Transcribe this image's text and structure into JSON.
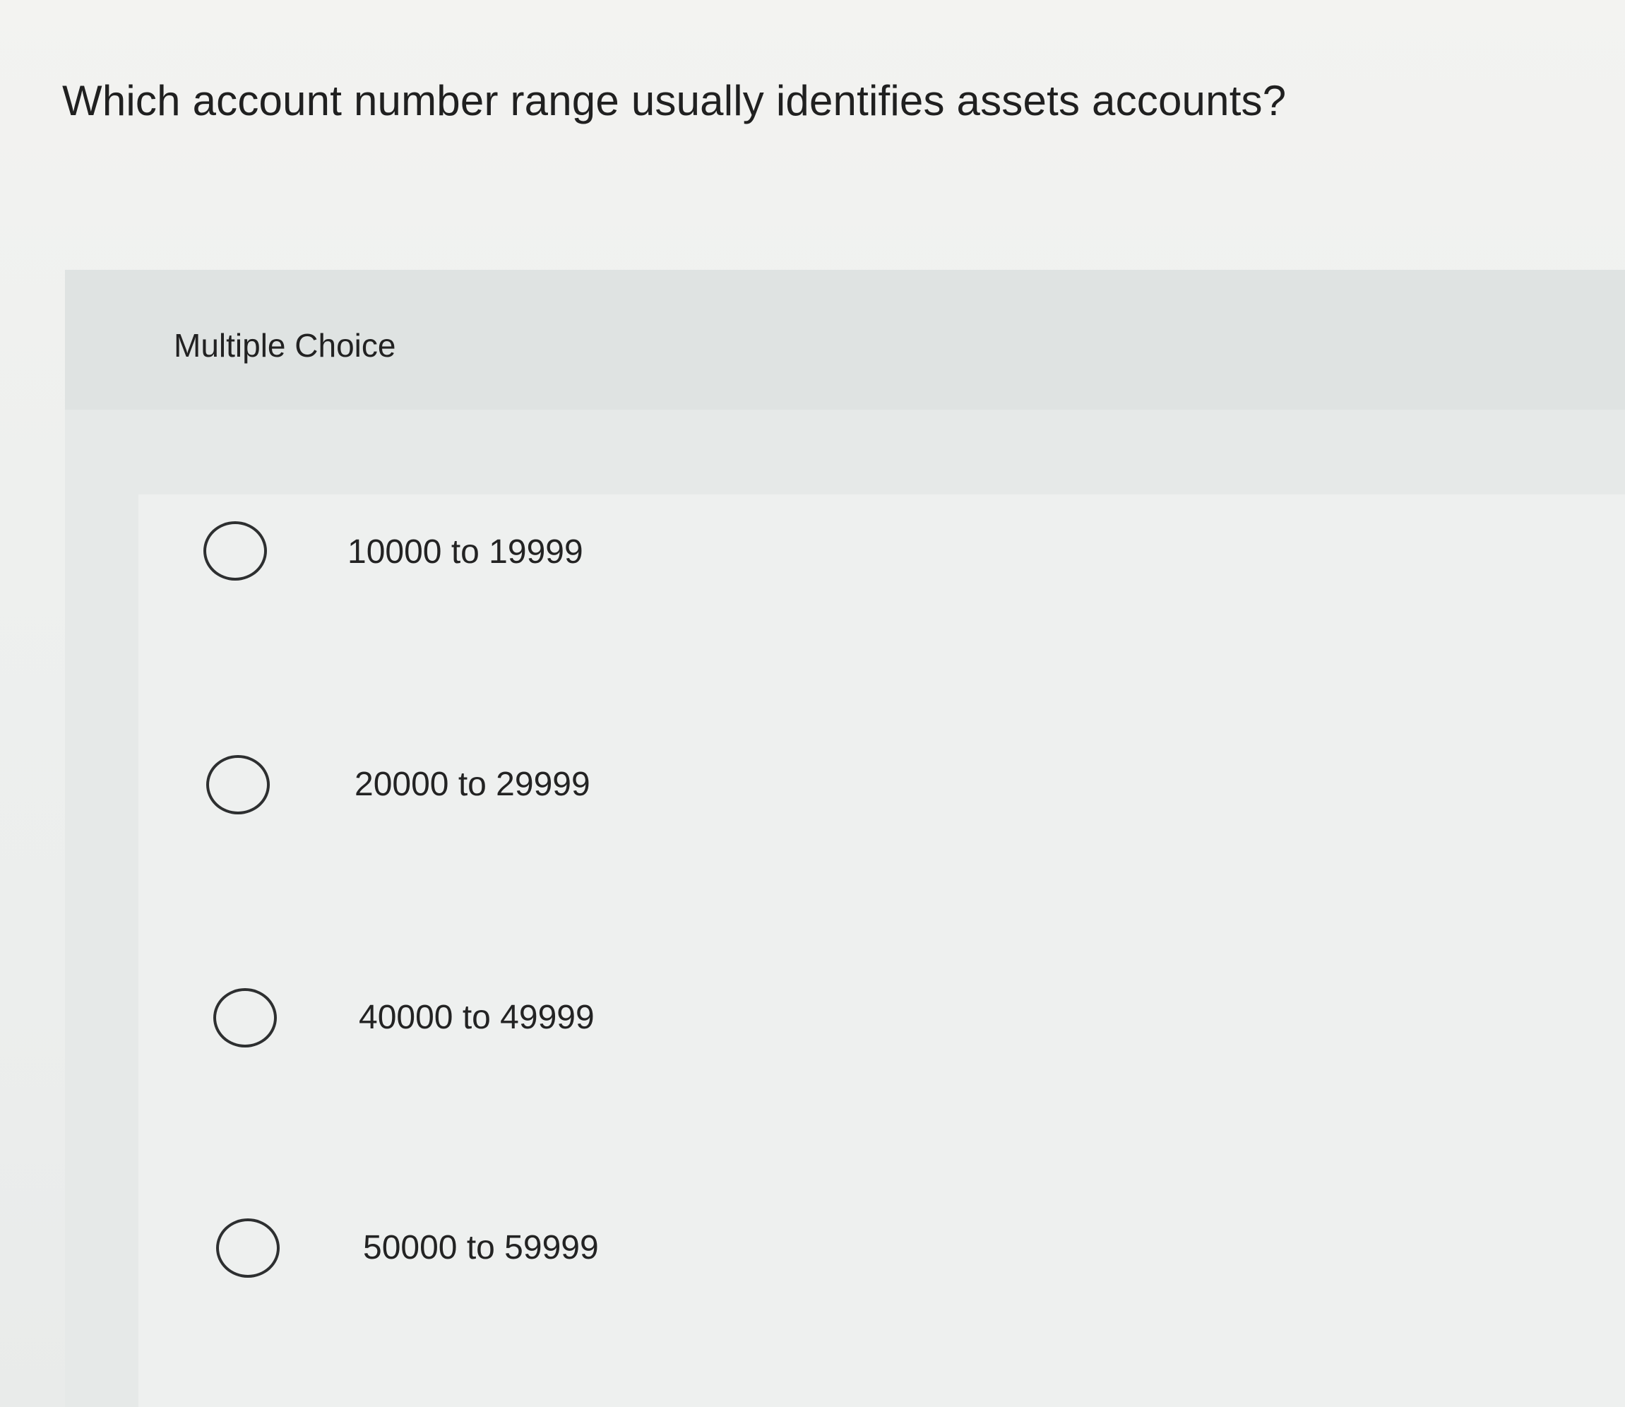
{
  "question": {
    "text": "Which account number range usually identifies assets accounts?"
  },
  "panel": {
    "label": "Multiple Choice"
  },
  "options": [
    {
      "label": "10000 to 19999"
    },
    {
      "label": "20000 to 29999"
    },
    {
      "label": "40000 to 49999"
    },
    {
      "label": "50000 to 59999"
    }
  ],
  "colors": {
    "background": "#eef0ef",
    "panel_header": "#dfe3e2",
    "radio_border": "#2d2f30",
    "text": "#222222"
  },
  "icons": {
    "radio": "radio-circle-unselected"
  }
}
